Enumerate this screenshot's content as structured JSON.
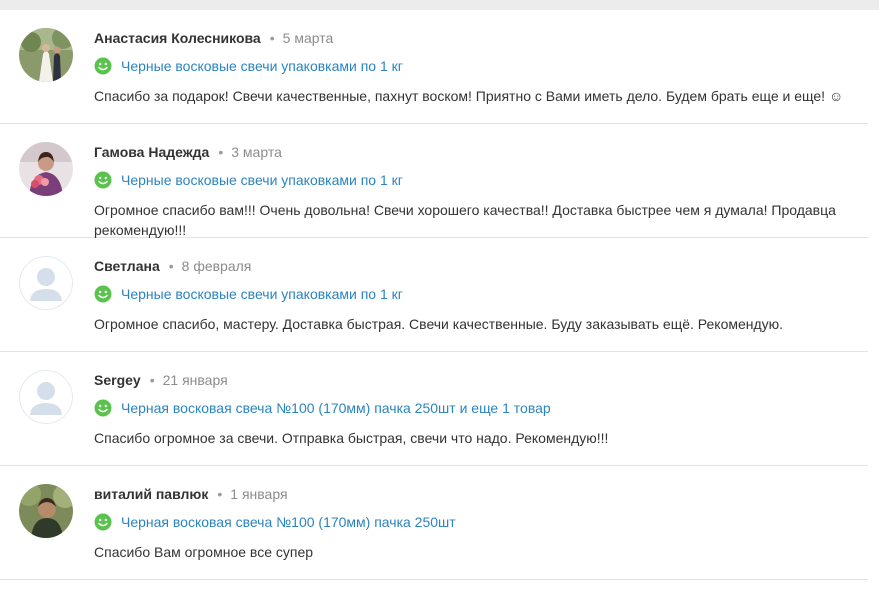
{
  "reviews": [
    {
      "author": "Анастасия Колесникова",
      "separator": "•",
      "date": "5 марта",
      "product": "Черные восковые свечи упаковками по 1 кг",
      "text": "Спасибо за подарок! Свечи качественные, пахнут воском! Приятно с Вами иметь дело. Будем брать еще и еще! ☺",
      "avatar": "photo"
    },
    {
      "author": "Гамова Надежда",
      "separator": "•",
      "date": "3 марта",
      "product": "Черные восковые свечи упаковками по 1 кг",
      "text": "Огромное спасибо вам!!! Очень довольна! Свечи хорошего качества!! Доставка быстрее чем я думала! Продавца рекомендую!!!",
      "avatar": "photo"
    },
    {
      "author": "Светлана",
      "separator": "•",
      "date": "8 февраля",
      "product": "Черные восковые свечи упаковками по 1 кг",
      "text": "Огромное спасибо, мастеру. Доставка быстрая. Свечи качественные. Буду заказывать ещё. Рекомендую.",
      "avatar": "placeholder"
    },
    {
      "author": "Sergey",
      "separator": "•",
      "date": "21 января",
      "product": "Черная восковая свеча №100 (170мм) пачка 250шт и еще 1 товар",
      "text": "Спасибо огромное за свечи. Отправка быстрая, свечи что надо. Рекомендую!!!",
      "avatar": "placeholder"
    },
    {
      "author": "виталий павлюк",
      "separator": "•",
      "date": "1 января",
      "product": "Черная восковая свеча №100 (170мм) пачка 250шт",
      "text": "Спасибо Вам огромное все супер",
      "avatar": "photo"
    }
  ],
  "colors": {
    "link": "#2b84c0",
    "smile_green": "#5cc24e",
    "placeholder_bg": "#e9eef4",
    "placeholder_fg": "#c5d3e2"
  },
  "icons": {
    "rating": "positive-smile-icon"
  }
}
